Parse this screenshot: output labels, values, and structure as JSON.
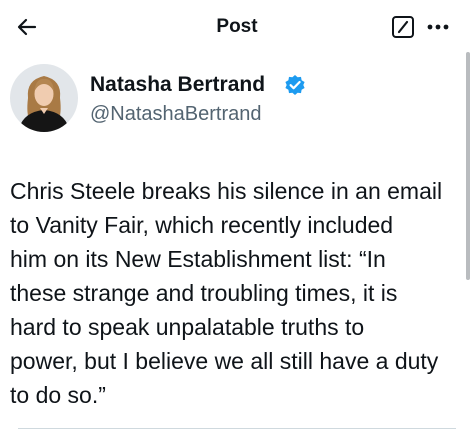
{
  "header": {
    "title": "Post",
    "back_icon": "arrow-left-icon",
    "edit_icon": "edit-square-icon",
    "more_icon": "more-horizontal-icon"
  },
  "author": {
    "display_name": "Natasha Bertrand",
    "handle": "@NatashaBertrand",
    "verified": true,
    "verified_icon": "verified-badge-icon",
    "verified_color": "#1d9bf0"
  },
  "tweet": {
    "lines": [
      "Chris Steele breaks his silence in an email",
      "to Vanity Fair, which recently included",
      "him on its New Establishment list: “In",
      "these strange and troubling times, it is",
      "hard to speak unpalatable truths to",
      "power, but I believe we all still have a duty",
      "to do so.”"
    ]
  },
  "colors": {
    "text": "#0f1419",
    "secondary_text": "#536471",
    "background": "#ffffff"
  }
}
